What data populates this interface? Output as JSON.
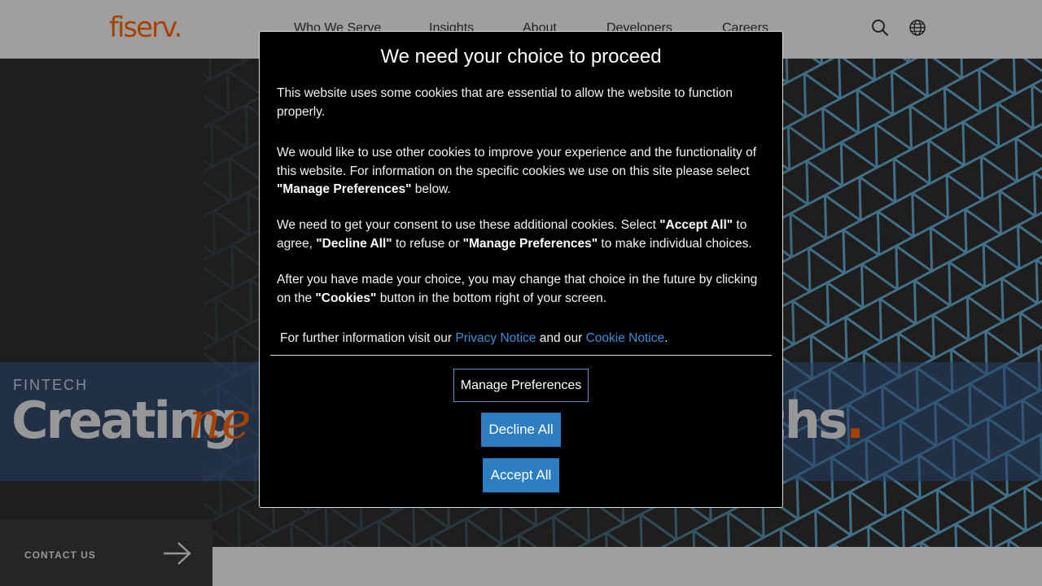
{
  "header": {
    "logo": "fiserv.",
    "nav": [
      "Who We Serve",
      "Insights",
      "About",
      "Developers",
      "Careers"
    ],
    "icons": {
      "search": "search-icon",
      "language": "globe-icon"
    }
  },
  "hero": {
    "eyebrow": "FINTECH",
    "headline_start": "Creating",
    "headline_accent": "ne",
    "headline_end": "chs",
    "headline_dot": "."
  },
  "contact": {
    "label": "CONTACT US",
    "icon": "arrow-right-icon"
  },
  "modal": {
    "title": "We need your choice to proceed",
    "p1": "This website uses some cookies that are essential to allow the website to function properly.",
    "p2_pre": "We would like to use other cookies to improve your experience and the functionality of this website. For information on the specific cookies we use on this site please select ",
    "p2_bold": "\"Manage Preferences\"",
    "p2_post": " below.",
    "p3_pre": "We need to get your consent to use these additional cookies. Select ",
    "p3_bold1": "\"Accept All\"",
    "p3_mid1": " to agree, ",
    "p3_bold2": "\"Decline All\"",
    "p3_mid2": " to refuse or ",
    "p3_bold3": "\"Manage Preferences\"",
    "p3_post": " to make individual choices.",
    "p4_pre": "After you have made your choice, you may change that choice in the future by clicking on the ",
    "p4_bold": "\"Cookies\"",
    "p4_post": " button in the bottom right of your screen.",
    "info_pre": "For further information visit our ",
    "privacy_link": "Privacy Notice",
    "info_mid": " and our ",
    "cookie_link": "Cookie Notice",
    "info_post": ".",
    "buttons": {
      "manage": "Manage Preferences",
      "decline": "Decline All",
      "accept": "Accept All"
    }
  },
  "colors": {
    "brand": "#ff6600",
    "button": "#2d7dc1",
    "link": "#3d8fd6",
    "modal_bg": "#000000"
  }
}
